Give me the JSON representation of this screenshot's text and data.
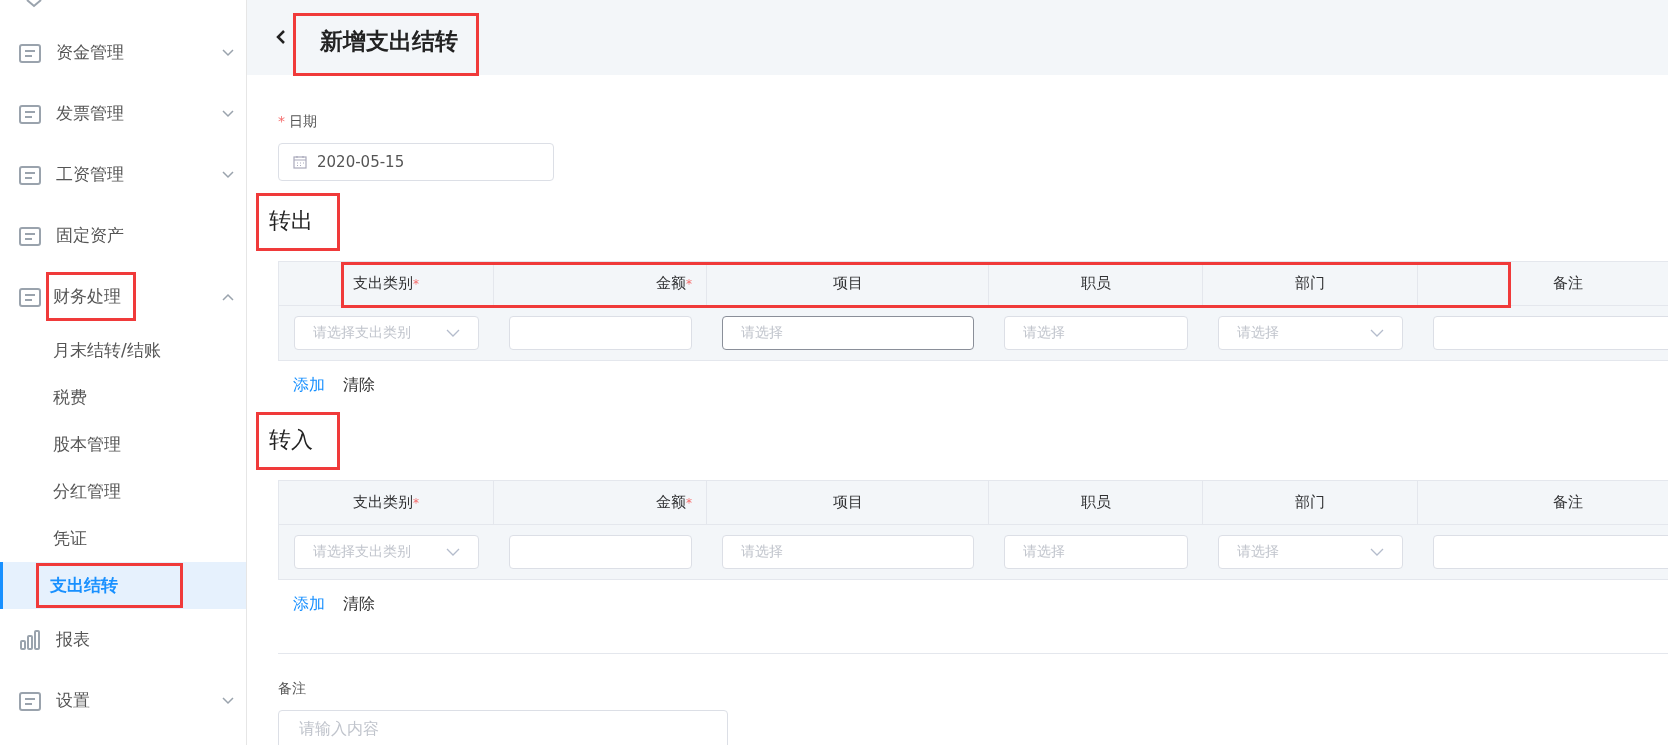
{
  "sidebar": {
    "items": [
      {
        "label": "资金管理",
        "kind": "group",
        "expanded": false,
        "highlighted": false
      },
      {
        "label": "发票管理",
        "kind": "group",
        "expanded": false,
        "highlighted": false
      },
      {
        "label": "工资管理",
        "kind": "group",
        "expanded": false,
        "highlighted": false
      },
      {
        "label": "固定资产",
        "kind": "link",
        "highlighted": false
      },
      {
        "label": "财务处理",
        "kind": "group",
        "expanded": true,
        "highlighted": true,
        "children": [
          {
            "label": "月末结转/结账",
            "selected": false,
            "highlighted": false
          },
          {
            "label": "税费",
            "selected": false,
            "highlighted": false
          },
          {
            "label": "股本管理",
            "selected": false,
            "highlighted": false
          },
          {
            "label": "分红管理",
            "selected": false,
            "highlighted": false
          },
          {
            "label": "凭证",
            "selected": false,
            "highlighted": false
          },
          {
            "label": "支出结转",
            "selected": true,
            "highlighted": true
          }
        ]
      },
      {
        "label": "报表",
        "kind": "link",
        "highlighted": false
      },
      {
        "label": "设置",
        "kind": "group",
        "expanded": false,
        "highlighted": false
      }
    ]
  },
  "page": {
    "title": "新增支出结转",
    "title_highlighted": true
  },
  "date": {
    "label": "日期",
    "required_mark": "*",
    "value": "2020-05-15"
  },
  "sections": [
    {
      "heading": "转出",
      "highlighted": true,
      "header_highlighted": true,
      "columns": [
        {
          "label": "支出类别",
          "required_mark": "*"
        },
        {
          "label": "金额",
          "required_mark": "*"
        },
        {
          "label": "项目"
        },
        {
          "label": "职员"
        },
        {
          "label": "部门"
        },
        {
          "label": "备注"
        }
      ],
      "row": [
        {
          "kind": "select",
          "placeholder": "请选择支出类别",
          "focused": false
        },
        {
          "kind": "input",
          "focused": false
        },
        {
          "kind": "input",
          "placeholder": "请选择",
          "focused": true
        },
        {
          "kind": "input",
          "placeholder": "请选择",
          "focused": false
        },
        {
          "kind": "select",
          "placeholder": "请选择",
          "focused": false
        },
        {
          "kind": "input",
          "focused": false
        }
      ],
      "actions": [
        "添加",
        "清除"
      ]
    },
    {
      "heading": "转入",
      "highlighted": true,
      "columns": [
        {
          "label": "支出类别",
          "required_mark": "*"
        },
        {
          "label": "金额",
          "required_mark": "*"
        },
        {
          "label": "项目"
        },
        {
          "label": "职员"
        },
        {
          "label": "部门"
        },
        {
          "label": "备注"
        }
      ],
      "row": [
        {
          "kind": "select",
          "placeholder": "请选择支出类别",
          "focused": false
        },
        {
          "kind": "input",
          "focused": false
        },
        {
          "kind": "input",
          "placeholder": "请选择",
          "focused": false
        },
        {
          "kind": "input",
          "placeholder": "请选择",
          "focused": false
        },
        {
          "kind": "select",
          "placeholder": "请选择",
          "focused": false
        },
        {
          "kind": "input",
          "focused": false
        }
      ],
      "actions": [
        "添加",
        "清除"
      ]
    }
  ],
  "remark": {
    "label": "备注",
    "placeholder": "请输入内容"
  }
}
